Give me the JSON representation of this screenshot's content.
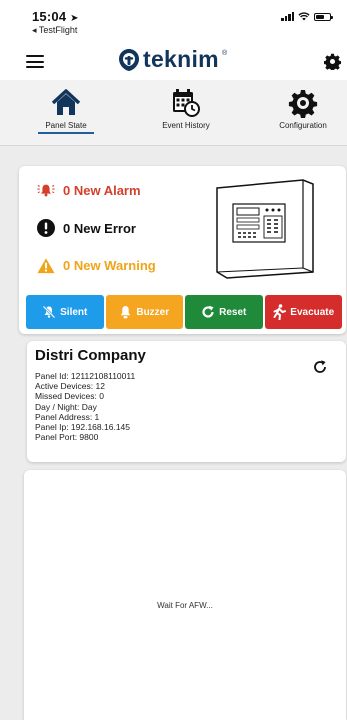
{
  "status_bar": {
    "time": "15:04",
    "back_label": "◂ TestFlight"
  },
  "header": {
    "brand": "teknim",
    "brand_mark": "®"
  },
  "tabs": [
    {
      "label": "Panel State",
      "icon": "home-icon",
      "active": true
    },
    {
      "label": "Event History",
      "icon": "calendar-clock-icon",
      "active": false
    },
    {
      "label": "Configuration",
      "icon": "cog-icon",
      "active": false
    }
  ],
  "alerts": {
    "alarm": "0 New Alarm",
    "error": "0 New Error",
    "warning": "0 New Warning"
  },
  "actions": {
    "silent": "Silent",
    "buzzer": "Buzzer",
    "reset": "Reset",
    "evacuate": "Evacuate"
  },
  "panel": {
    "company": "Distri Company",
    "lines": [
      "Panel Id: 12112108110011",
      "Active Devices: 12",
      "Missed Devices: 0",
      "Day / Night: Day",
      "Panel Address: 1",
      "Panel Ip: 192.168.16.145",
      "Panel Port: 9800"
    ]
  },
  "wait_message": "Wait For AFW...",
  "colors": {
    "alarm": "#d4402c",
    "warning": "#f0a417",
    "silent": "#1e9be9",
    "buzzer": "#f6a520",
    "reset": "#1f8a3a",
    "evacuate": "#d42d2b",
    "brand": "#12355c"
  }
}
